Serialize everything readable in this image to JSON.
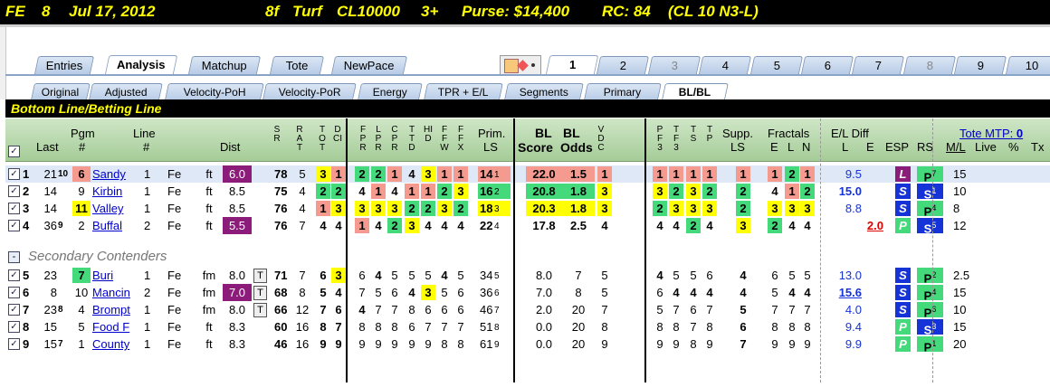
{
  "header": {
    "track": "FE",
    "race": "8",
    "date": "Jul 17, 2012",
    "distance": "8f",
    "surface": "Turf",
    "class": "CL10000",
    "age": "3+",
    "purse": "Purse: $14,400",
    "rc": "RC: 84",
    "cond": "(CL 10 N3-L)"
  },
  "main_tabs": [
    "Entries",
    "Analysis",
    "Matchup",
    "Tote",
    "NewPace"
  ],
  "race_tabs": [
    "1",
    "2",
    "3",
    "4",
    "5",
    "6",
    "7",
    "8",
    "9",
    "10"
  ],
  "sub_tabs": [
    "Original",
    "Adjusted",
    "Velocity-PoH",
    "Velocity-PoR",
    "Energy",
    "TPR + E/L",
    "Segments",
    "Primary",
    "BL/BL"
  ],
  "section_title": "Bottom Line/Betting Line",
  "secondary_label": "Secondary Contenders",
  "collapse_glyph": "-",
  "check_glyph": "✓",
  "tote_mtp_label": "Tote MTP:",
  "tote_mtp_value": "0",
  "columns": {
    "last": "Last",
    "pgm": "Pgm",
    "pgm2": "#",
    "line": "Line",
    "line2": "#",
    "dist": "Dist",
    "prim": "Prim.",
    "prim2": "LS",
    "bl1": "BL",
    "bl2": "BL",
    "score": "Score",
    "odds": "Odds",
    "supp": "Supp.",
    "supp2": "LS",
    "fractals": "Fractals",
    "e": "E",
    "l": "L",
    "n": "N",
    "eldiff": "E/L Diff",
    "el_l": "L",
    "el_e": "E",
    "esp": "ESP",
    "rs": "RS",
    "ml": "M/L",
    "live": "Live",
    "pct": "%",
    "tx": "Tx",
    "sr": "SR",
    "ratdci": [
      "RAT",
      "TOT",
      "DCI"
    ],
    "fprs": [
      "FPR",
      "LPR",
      "CPR",
      "TTD",
      "HID",
      "FFW",
      "FFX"
    ],
    "vdc": "VDC",
    "pft": [
      "PF3",
      "TF3",
      "TS",
      "TP"
    ]
  },
  "main_rows": [
    {
      "n": "1",
      "last": "21",
      "lastsub": "10",
      "pgm": "6",
      "pgm_hl": "r",
      "name": "Sandy",
      "line": "1",
      "fe": "Fe",
      "surf": "ft",
      "dist": "6.0",
      "dist_hl": true,
      "sr": "78",
      "rat": [
        "5",
        "3",
        "1"
      ],
      "rat_hl": [
        "",
        "y",
        "r"
      ],
      "fp": [
        "2",
        "2",
        "1",
        "4",
        "3",
        "1",
        "1"
      ],
      "fp_hl": [
        "g",
        "g",
        "r",
        "",
        "y",
        "r",
        "r"
      ],
      "prim": "14",
      "prim_sub": "1",
      "prim_hl": "r",
      "score": "22.0",
      "odds": "1.5",
      "vdc": "1",
      "bl_hl": "r",
      "vdc_hl": "r",
      "pft": [
        "1",
        "1",
        "1",
        "1"
      ],
      "pft_hl": [
        "r",
        "r",
        "r",
        "r"
      ],
      "supp": "1",
      "supp_hl": "r",
      "fr": [
        "1",
        "2",
        "1"
      ],
      "fr_hl": [
        "r",
        "g",
        "r"
      ],
      "el_l": "9.5",
      "el_l_style": "",
      "el_e": "",
      "esp": "L",
      "esp_c": "#8b1c7a",
      "rs": "P",
      "rs_sup": "7",
      "rs_c": "#44d97a",
      "ml": "15",
      "sel": true
    },
    {
      "n": "2",
      "last": "14",
      "lastsub": "",
      "pgm": "9",
      "pgm_hl": "",
      "name": "Kirbin",
      "line": "1",
      "fe": "Fe",
      "surf": "ft",
      "dist": "8.5",
      "dist_hl": false,
      "sr": "75",
      "rat": [
        "4",
        "2",
        "2"
      ],
      "rat_hl": [
        "",
        "g",
        "g"
      ],
      "fp": [
        "4",
        "1",
        "4",
        "1",
        "1",
        "2",
        "3"
      ],
      "fp_hl": [
        "",
        "r",
        "",
        "r",
        "r",
        "g",
        "y"
      ],
      "prim": "16",
      "prim_sub": "2",
      "prim_hl": "g",
      "score": "20.8",
      "odds": "1.8",
      "vdc": "3",
      "bl_hl": "g",
      "vdc_hl": "y",
      "pft": [
        "3",
        "2",
        "3",
        "2"
      ],
      "pft_hl": [
        "y",
        "g",
        "y",
        "g"
      ],
      "supp": "2",
      "supp_hl": "g",
      "fr": [
        "4",
        "1",
        "2"
      ],
      "fr_hl": [
        "",
        "r",
        "g"
      ],
      "el_l": "15.0",
      "el_l_style": "bold",
      "el_e": "",
      "esp": "S",
      "esp_c": "#1533d6",
      "rs": "S",
      "rs_sup": "1",
      "rs_c": "#1533d6",
      "ml": "10",
      "sel": false
    },
    {
      "n": "3",
      "last": "14",
      "lastsub": "",
      "pgm": "11",
      "pgm_hl": "y",
      "name": "Valley",
      "line": "1",
      "fe": "Fe",
      "surf": "ft",
      "dist": "8.5",
      "dist_hl": false,
      "sr": "76",
      "rat": [
        "4",
        "1",
        "3"
      ],
      "rat_hl": [
        "",
        "r",
        "y"
      ],
      "fp": [
        "3",
        "3",
        "3",
        "2",
        "2",
        "3",
        "2"
      ],
      "fp_hl": [
        "y",
        "y",
        "y",
        "g",
        "g",
        "y",
        "g"
      ],
      "prim": "18",
      "prim_sub": "3",
      "prim_hl": "y",
      "score": "20.3",
      "odds": "1.8",
      "vdc": "3",
      "bl_hl": "y",
      "vdc_hl": "y",
      "pft": [
        "2",
        "3",
        "3",
        "3"
      ],
      "pft_hl": [
        "g",
        "y",
        "y",
        "y"
      ],
      "supp": "2",
      "supp_hl": "g",
      "fr": [
        "3",
        "3",
        "3"
      ],
      "fr_hl": [
        "y",
        "y",
        "y"
      ],
      "el_l": "8.8",
      "el_l_style": "",
      "el_e": "",
      "esp": "S",
      "esp_c": "#1533d6",
      "rs": "P",
      "rs_sup": "4",
      "rs_c": "#44d97a",
      "ml": "8",
      "sel": false
    },
    {
      "n": "4",
      "last": "36",
      "lastsub": "9",
      "pgm": "2",
      "pgm_hl": "",
      "name": "Buffal",
      "line": "2",
      "fe": "Fe",
      "surf": "ft",
      "dist": "5.5",
      "dist_hl": true,
      "sr": "76",
      "rat": [
        "7",
        "4",
        "4"
      ],
      "rat_hl": [
        "",
        "",
        ""
      ],
      "fp": [
        "1",
        "4",
        "2",
        "3",
        "4",
        "4",
        "4"
      ],
      "fp_hl": [
        "r",
        "",
        "g",
        "y",
        "",
        "",
        ""
      ],
      "prim": "22",
      "prim_sub": "4",
      "prim_hl": "",
      "score": "17.8",
      "odds": "2.5",
      "vdc": "4",
      "bl_hl": "",
      "vdc_hl": "",
      "pft": [
        "4",
        "4",
        "2",
        "4"
      ],
      "pft_hl": [
        "",
        "",
        "g",
        ""
      ],
      "supp": "3",
      "supp_hl": "y",
      "fr": [
        "2",
        "4",
        "4"
      ],
      "fr_hl": [
        "g",
        "",
        ""
      ],
      "el_l": "",
      "el_l_style": "",
      "el_e": "2.0",
      "esp": "P",
      "esp_c": "#44d97a",
      "rs": "S",
      "rs_sup": "5",
      "rs_c": "#1533d6",
      "ml": "12",
      "sel": false
    }
  ],
  "sec_rows": [
    {
      "n": "5",
      "last": "23",
      "lastsub": "",
      "pgm": "7",
      "pgm_hl": "g",
      "name": "Buri",
      "line": "1",
      "fe": "Fe",
      "surf": "fm",
      "dist": "8.0",
      "dist_hl": false,
      "t": "T",
      "sr": "71",
      "rat": [
        "7",
        "6",
        "3"
      ],
      "rat_hl": [
        "",
        "",
        "y"
      ],
      "fp": [
        "6",
        "4",
        "5",
        "5",
        "5",
        "4",
        "5"
      ],
      "fp_b": [
        0,
        1,
        0,
        0,
        0,
        1,
        0
      ],
      "fp_hl": [
        "",
        "",
        "",
        "",
        "",
        "",
        ""
      ],
      "prim": "34",
      "prim_sub": "5",
      "score": "8.0",
      "odds": "7",
      "vdc": "5",
      "pft": [
        "4",
        "5",
        "5",
        "6"
      ],
      "pft_b": [
        1,
        0,
        0,
        0
      ],
      "supp": "4",
      "fr": [
        "6",
        "5",
        "5"
      ],
      "fr_b": [
        0,
        0,
        0
      ],
      "el_l": "13.0",
      "el_l_style": "",
      "esp": "S",
      "esp_c": "#1533d6",
      "rs": "P",
      "rs_sup": "2",
      "rs_c": "#44d97a",
      "ml": "2.5"
    },
    {
      "n": "6",
      "last": "8",
      "lastsub": "",
      "pgm": "10",
      "pgm_hl": "",
      "name": "Mancin",
      "line": "2",
      "fe": "Fe",
      "surf": "fm",
      "dist": "7.0",
      "dist_hl": true,
      "t": "T",
      "sr": "68",
      "rat": [
        "8",
        "5",
        "4"
      ],
      "rat_hl": [
        "",
        "",
        ""
      ],
      "fp": [
        "7",
        "5",
        "6",
        "4",
        "3",
        "5",
        "6"
      ],
      "fp_b": [
        0,
        0,
        0,
        1,
        0,
        0,
        0
      ],
      "fp_hl": [
        "",
        "",
        "",
        "",
        "y",
        "",
        ""
      ],
      "prim": "36",
      "prim_sub": "6",
      "score": "7.0",
      "odds": "8",
      "vdc": "5",
      "pft": [
        "6",
        "4",
        "4",
        "4"
      ],
      "pft_b": [
        0,
        1,
        1,
        1
      ],
      "supp": "4",
      "fr": [
        "5",
        "4",
        "4"
      ],
      "fr_b": [
        0,
        1,
        1
      ],
      "el_l": "15.6",
      "el_l_style": "ul",
      "esp": "S",
      "esp_c": "#1533d6",
      "rs": "P",
      "rs_sup": "4",
      "rs_c": "#44d97a",
      "ml": "15"
    },
    {
      "n": "7",
      "last": "23",
      "lastsub": "8",
      "pgm": "4",
      "pgm_hl": "",
      "name": "Brompt",
      "line": "1",
      "fe": "Fe",
      "surf": "fm",
      "dist": "8.0",
      "dist_hl": false,
      "t": "T",
      "sr": "66",
      "rat": [
        "12",
        "7",
        "6"
      ],
      "rat_hl": [
        "",
        "",
        ""
      ],
      "fp": [
        "4",
        "7",
        "7",
        "8",
        "6",
        "6",
        "6"
      ],
      "fp_b": [
        1,
        0,
        0,
        0,
        0,
        0,
        0
      ],
      "fp_hl": [
        "",
        "",
        "",
        "",
        "",
        "",
        ""
      ],
      "prim": "46",
      "prim_sub": "7",
      "score": "2.0",
      "odds": "20",
      "vdc": "7",
      "pft": [
        "5",
        "7",
        "6",
        "7"
      ],
      "pft_b": [
        0,
        0,
        0,
        0
      ],
      "supp": "5",
      "fr": [
        "7",
        "7",
        "7"
      ],
      "fr_b": [
        0,
        0,
        0
      ],
      "el_l": "4.0",
      "el_l_style": "",
      "esp": "S",
      "esp_c": "#1533d6",
      "rs": "P",
      "rs_sup": "6",
      "rs_c": "#44d97a",
      "ml": "10"
    },
    {
      "n": "8",
      "last": "15",
      "lastsub": "",
      "pgm": "5",
      "pgm_hl": "",
      "name": "Food F",
      "line": "1",
      "fe": "Fe",
      "surf": "ft",
      "dist": "8.3",
      "dist_hl": false,
      "t": "",
      "sr": "60",
      "rat": [
        "16",
        "8",
        "7"
      ],
      "rat_hl": [
        "",
        "",
        ""
      ],
      "fp": [
        "8",
        "8",
        "8",
        "6",
        "7",
        "7",
        "7"
      ],
      "fp_b": [
        0,
        0,
        0,
        0,
        0,
        0,
        0
      ],
      "fp_hl": [
        "",
        "",
        "",
        "",
        "",
        "",
        ""
      ],
      "prim": "51",
      "prim_sub": "8",
      "score": "0.0",
      "odds": "20",
      "vdc": "8",
      "pft": [
        "8",
        "8",
        "7",
        "8"
      ],
      "pft_b": [
        0,
        0,
        0,
        0
      ],
      "supp": "6",
      "fr": [
        "8",
        "8",
        "8"
      ],
      "fr_b": [
        0,
        0,
        0
      ],
      "el_l": "9.4",
      "el_l_style": "",
      "esp": "P",
      "esp_c": "#44d97a",
      "rs": "S",
      "rs_sup": "3",
      "rs_c": "#1533d6",
      "ml": "15"
    },
    {
      "n": "9",
      "last": "15",
      "lastsub": "7",
      "pgm": "1",
      "pgm_hl": "",
      "name": "County",
      "line": "1",
      "fe": "Fe",
      "surf": "ft",
      "dist": "8.3",
      "dist_hl": false,
      "t": "",
      "sr": "46",
      "rat": [
        "16",
        "9",
        "9"
      ],
      "rat_hl": [
        "",
        "",
        ""
      ],
      "fp": [
        "9",
        "9",
        "9",
        "9",
        "9",
        "8",
        "8"
      ],
      "fp_b": [
        0,
        0,
        0,
        0,
        0,
        0,
        0
      ],
      "fp_hl": [
        "",
        "",
        "",
        "",
        "",
        "",
        ""
      ],
      "prim": "61",
      "prim_sub": "9",
      "score": "0.0",
      "odds": "20",
      "vdc": "9",
      "pft": [
        "9",
        "9",
        "8",
        "9"
      ],
      "pft_b": [
        0,
        0,
        0,
        0
      ],
      "supp": "7",
      "fr": [
        "9",
        "9",
        "9"
      ],
      "fr_b": [
        0,
        0,
        0
      ],
      "el_l": "9.9",
      "el_l_style": "",
      "esp": "P",
      "esp_c": "#44d97a",
      "rs": "P",
      "rs_sup": "1",
      "rs_c": "#44d97a",
      "ml": "20"
    }
  ]
}
